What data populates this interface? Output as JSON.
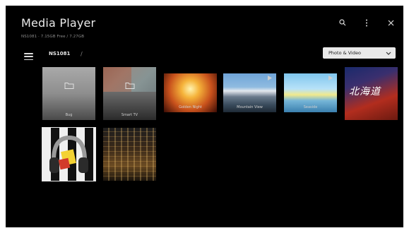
{
  "header": {
    "title": "Media Player",
    "storage": "NS1081 · 7.15GB Free / 7.27GB"
  },
  "nav": {
    "breadcrumb": "NS1081",
    "separator": "/",
    "filter_selected": "Photo & Video"
  },
  "icons": {
    "search": "search-icon",
    "more": "more-vert-icon",
    "close": "close-icon",
    "menu": "hamburger-menu-icon",
    "dropdown": "chevron-down-icon",
    "folder": "folder-icon",
    "video": "play-icon"
  },
  "items": [
    {
      "name": "Bug",
      "type": "folder"
    },
    {
      "name": "Smart TV",
      "type": "folder"
    },
    {
      "name": "Golden Night",
      "type": "video"
    },
    {
      "name": "Mountain View",
      "type": "video"
    },
    {
      "name": "Seaside",
      "type": "video"
    },
    {
      "name": "北海道",
      "type": "photo"
    },
    {
      "name": "",
      "type": "photo"
    },
    {
      "name": "",
      "type": "photo"
    }
  ],
  "colors": {
    "background": "#000000",
    "frame": "#ffffff",
    "dropdown_bg": "#e9e9e9",
    "text": "#eaeaea"
  }
}
